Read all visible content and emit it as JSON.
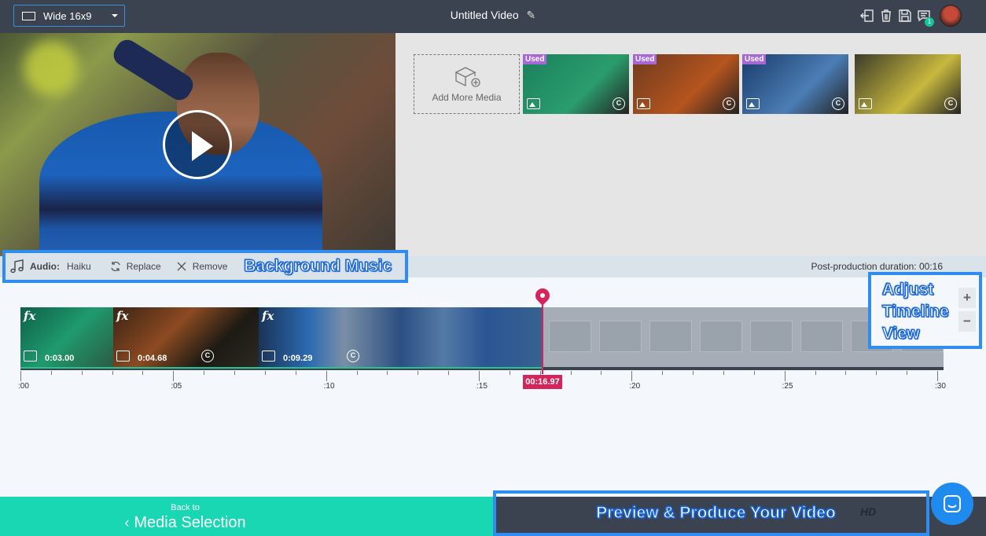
{
  "topbar": {
    "aspect_label": "Wide 16x9",
    "title": "Untitled Video",
    "notification_count": "1"
  },
  "library": {
    "add_media_label": "Add More Media",
    "thumbnails": [
      {
        "badge": "Used",
        "colors": [
          "#1b7f5e",
          "#2a9d6c"
        ]
      },
      {
        "badge": "Used",
        "colors": [
          "#6d3b1e",
          "#b5541e"
        ]
      },
      {
        "badge": "Used",
        "colors": [
          "#1a3c6a",
          "#4b7db5"
        ]
      },
      {
        "badge": "",
        "colors": [
          "#3c3b2a",
          "#c8b83e"
        ]
      }
    ]
  },
  "audio": {
    "label": "Audio:",
    "track": "Haiku",
    "replace_label": "Replace",
    "remove_label": "Remove",
    "callout": "Background Music"
  },
  "duration_label": "Post-production duration: 00:16",
  "timeline": {
    "clips": [
      {
        "fx": "fx",
        "time": "0:03.00",
        "cc": false
      },
      {
        "fx": "fx",
        "time": "0:04.68",
        "cc": true
      },
      {
        "fx": "fx",
        "time": "0:09.29",
        "cc": true
      }
    ],
    "ruler_labels": [
      ":00",
      ":05",
      ":10",
      ":15",
      ":20",
      ":25",
      ":30"
    ],
    "playhead_time": "00:16.97",
    "zoom_in": "+",
    "zoom_out": "−",
    "zoom_callout": [
      "Adjust",
      "Timeline",
      "View"
    ]
  },
  "bottom": {
    "back_to": "Back to",
    "back_target": "Media Selection",
    "produce_callout": "Preview & Produce Your Video",
    "hd": "HD"
  },
  "colors": {
    "accent": "#18d7b2",
    "callout_border": "#2f8cf0",
    "playhead": "#d6245b",
    "used_badge": "#a568d6"
  }
}
